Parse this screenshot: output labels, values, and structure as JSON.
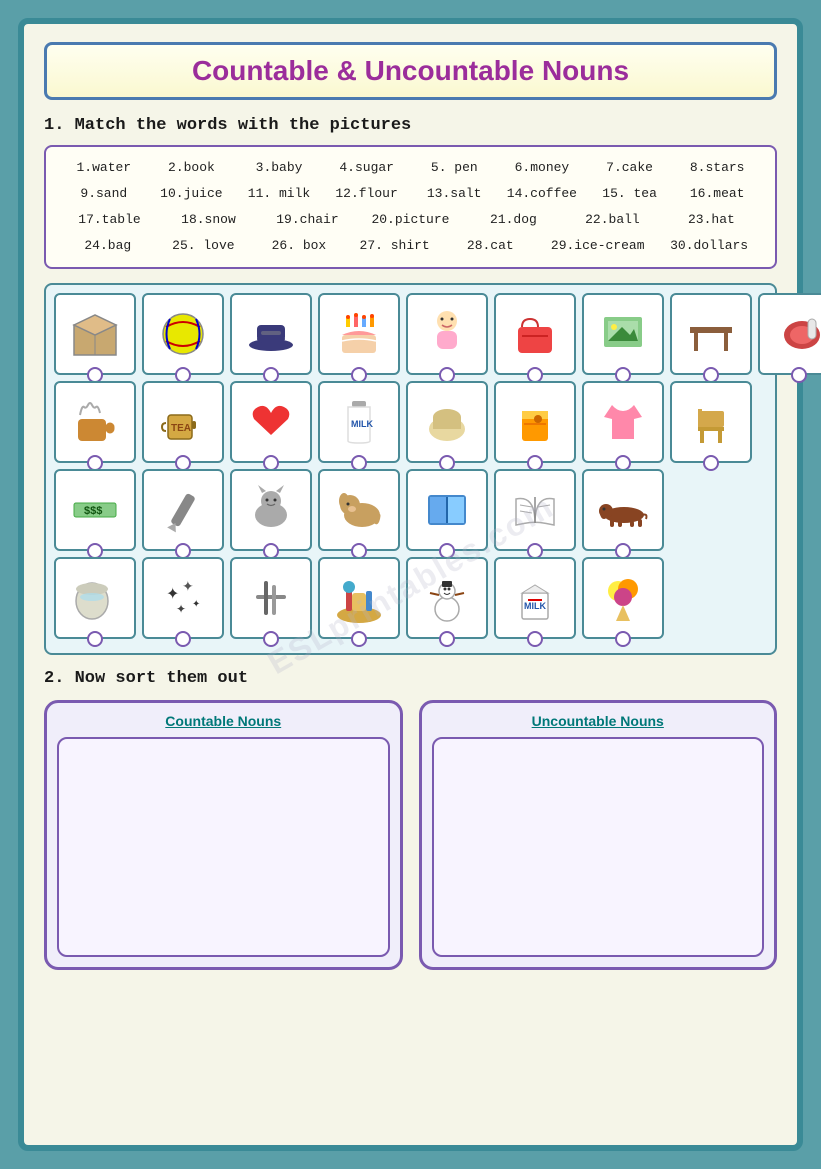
{
  "title": "Countable & Uncountable Nouns",
  "section1": {
    "label": "1.  Match the words with the pictures",
    "words_row1": [
      "1.water",
      "2.book",
      "3.baby",
      "4.sugar",
      "5. pen",
      "6.money",
      "7.cake",
      "8.stars"
    ],
    "words_row2": [
      "9.sand",
      "10.juice",
      "11. milk",
      "12.flour",
      "13.salt",
      "14.coffee",
      "15. tea",
      "16.meat"
    ],
    "words_row3": [
      "17.table",
      "18.snow",
      "19.chair",
      "20.picture",
      "21.dog",
      "22.ball",
      "23.hat"
    ],
    "words_row4": [
      "24.bag",
      "25. love",
      "26. box",
      "27. shirt",
      "28.cat",
      "29.ice-cream",
      "30.dollars"
    ]
  },
  "section2": {
    "label": "2. Now sort them out",
    "countable_label": "Countable Nouns",
    "uncountable_label": "Uncountable Nouns"
  },
  "images_row1": [
    {
      "emoji": "📦",
      "label": "box"
    },
    {
      "emoji": "🎾",
      "label": "ball"
    },
    {
      "emoji": "🎩",
      "label": "hat"
    },
    {
      "emoji": "🎂",
      "label": "cake"
    },
    {
      "emoji": "👶",
      "label": "baby"
    },
    {
      "emoji": "👜",
      "label": "bag"
    },
    {
      "emoji": "🖼️",
      "label": "picture"
    },
    {
      "emoji": "🪑",
      "label": "chair"
    },
    {
      "emoji": "🥩",
      "label": "meat"
    }
  ],
  "images_row2": [
    {
      "emoji": "☕",
      "label": "coffee"
    },
    {
      "emoji": "🫖",
      "label": "tea"
    },
    {
      "emoji": "❤️",
      "label": "love"
    },
    {
      "emoji": "🥛",
      "label": "milk"
    },
    {
      "emoji": "🌾",
      "label": "flour"
    },
    {
      "emoji": "🧃",
      "label": "juice"
    },
    {
      "emoji": "👕",
      "label": "shirt"
    },
    {
      "emoji": "🪑",
      "label": "chair2"
    }
  ],
  "images_row3": [
    {
      "emoji": "💵",
      "label": "money"
    },
    {
      "emoji": "✏️",
      "label": "pen"
    },
    {
      "emoji": "🐱",
      "label": "cat"
    },
    {
      "emoji": "🐶",
      "label": "dog"
    },
    {
      "emoji": "📗",
      "label": "book"
    },
    {
      "emoji": "📖",
      "label": "picture2"
    },
    {
      "emoji": "🦫",
      "label": "animal"
    }
  ],
  "images_row4": [
    {
      "emoji": "🥛",
      "label": "milk2"
    },
    {
      "emoji": "✨",
      "label": "stars"
    },
    {
      "emoji": "🔧",
      "label": "tools"
    },
    {
      "emoji": "🏖️",
      "label": "sand"
    },
    {
      "emoji": "⛄",
      "label": "snow"
    },
    {
      "emoji": "🥛",
      "label": "milk3"
    },
    {
      "emoji": "🍦",
      "label": "icecream"
    }
  ],
  "watermark": "ESLprintables.com"
}
